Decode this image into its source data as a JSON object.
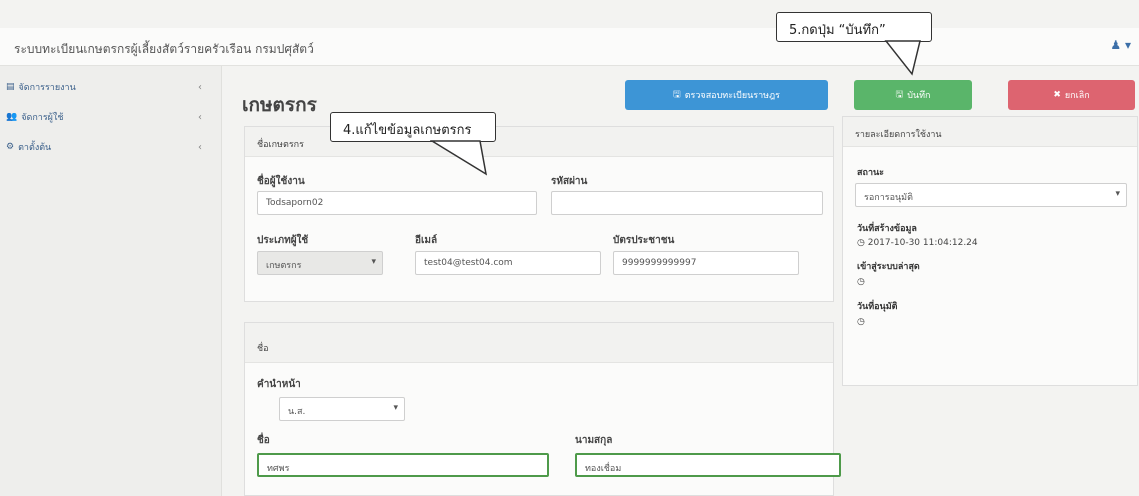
{
  "app": {
    "title": "ระบบทะเบียนเกษตรกรผู้เลี้ยงสัตว์รายครัวเรือน กรมปศุสัตว์",
    "user_icon": "user-icon"
  },
  "sidebar": {
    "items": [
      {
        "label": "จัดการรายงาน",
        "icon": "report-icon"
      },
      {
        "label": "จัดการผู้ใช้",
        "icon": "users-icon"
      },
      {
        "label": "ตาตั้งต้น",
        "icon": "gear-icon"
      }
    ]
  },
  "page": {
    "title": "เกษตรกร"
  },
  "actions": {
    "check_label": "ตรวจสอบทะเบียนราษฎร",
    "save_label": "บันทึก",
    "cancel_label": "ยกเลิก"
  },
  "account": {
    "heading": "ชื่อเกษตรกร",
    "username_label": "ชื่อผู้ใช้งาน",
    "username_value": "Todsaporn02",
    "password_label": "รหัสผ่าน",
    "password_value": "",
    "usertype_label": "ประเภทผู้ใช้",
    "usertype_value": "เกษตรกร",
    "email_label": "อีเมล์",
    "email_value": "test04@test04.com",
    "idcard_label": "บัตรประชาชน",
    "idcard_value": "9999999999997"
  },
  "name": {
    "heading": "ชื่อ",
    "prefix_label": "คำนำหน้า",
    "prefix_value": "น.ส.",
    "first_label": "ชื่อ",
    "first_value": "ทศพร",
    "last_label": "นามสกุล",
    "last_value": "ทองเชื่อม"
  },
  "status_panel": {
    "heading": "รายละเอียดการใช้งาน",
    "status_label": "สถานะ",
    "status_value": "รอการอนุมัติ",
    "created_label": "วันที่สร้างข้อมูล",
    "created_value": "2017-10-30 11:04:12.24",
    "lastlogin_label": "เข้าสู่ระบบล่าสุด",
    "lastlogin_value": "",
    "approved_label": "วันที่อนุมัติ",
    "approved_value": ""
  },
  "annotations": {
    "edit_note": "4.แก้ไขข้อมูลเกษตรกร",
    "save_note": "5.กดปุ่ม “บันทึก”"
  },
  "colors": {
    "blue": "#3d95d6",
    "green": "#5ab56a",
    "red": "#dd6470"
  }
}
